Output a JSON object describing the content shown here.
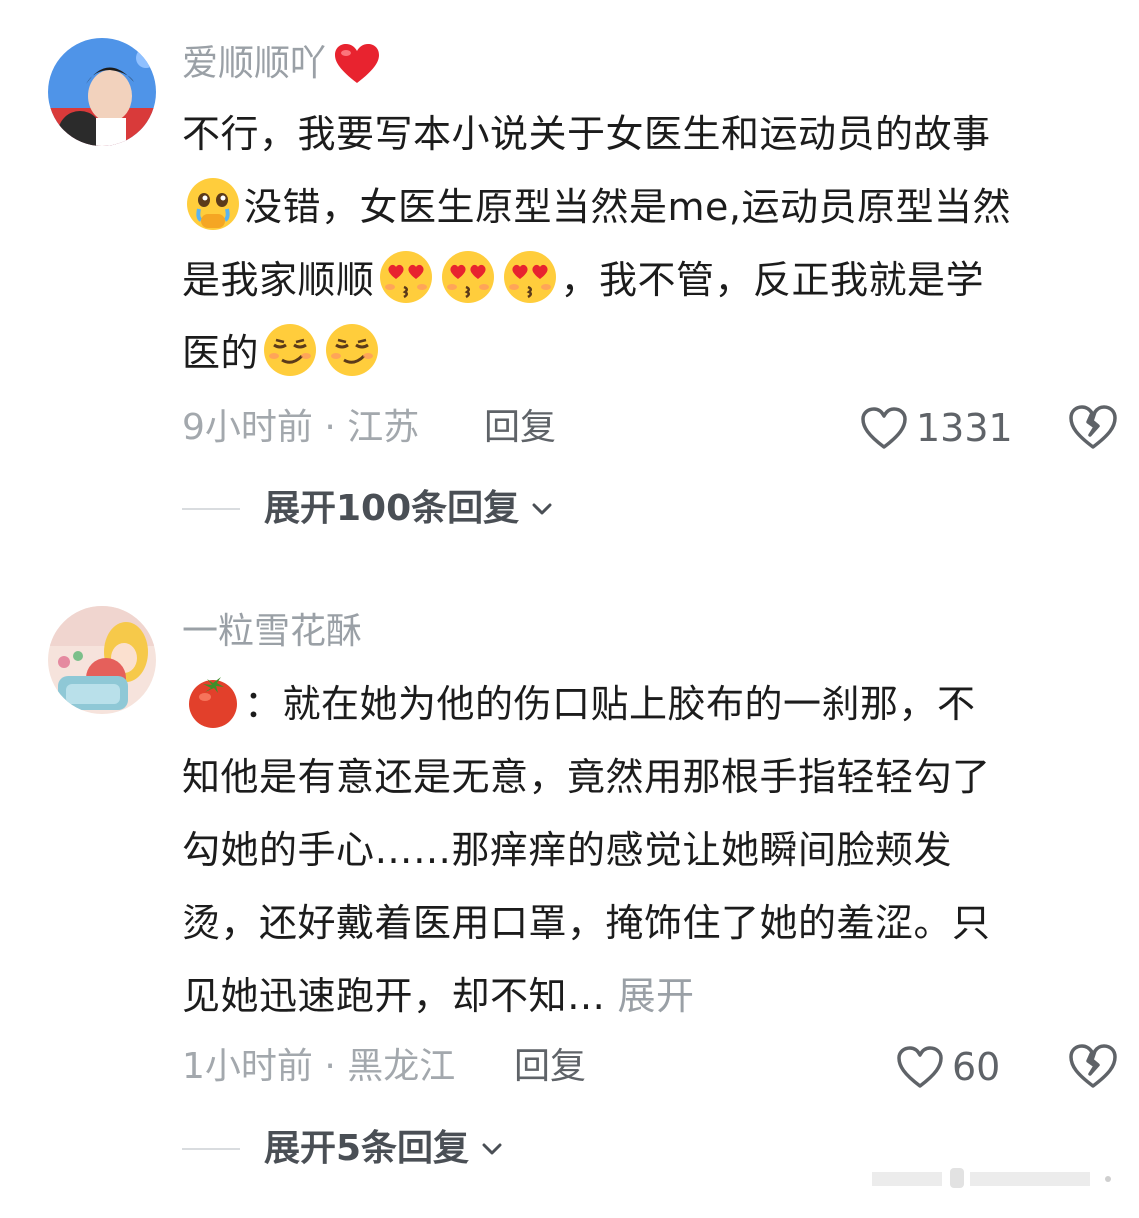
{
  "comments": [
    {
      "username": "爱顺顺吖",
      "text_line1": "不行，我要写本小说关于女医生和运动员的故事",
      "text_line2": "没错，女医生原型当然是me,运动员原型当然",
      "text_line3_a": "是我家顺顺",
      "text_line3_b": "，我不管，反正我就是学",
      "text_line4": "医的",
      "time": "9小时前",
      "location": "江苏",
      "separator": " · ",
      "reply_label": "回复",
      "likes": "1331",
      "expand_label": "展开100条回复",
      "icons": [
        "red-heart-icon",
        "holding-back-tears-emoji",
        "heart-eyes-kiss-emoji",
        "smirk-emoji",
        "heart-outline-icon",
        "broken-heart-icon",
        "chevron-down-icon"
      ]
    },
    {
      "username": "一粒雪花酥",
      "text_line1": "：就在她为他的伤口贴上胶布的一刹那，不",
      "text_line2": "知他是有意还是无意，竟然用那根手指轻轻勾了",
      "text_line3": "勾她的手心……那痒痒的感觉让她瞬间脸颊发",
      "text_line4": "烫，还好戴着医用口罩，掩饰住了她的羞涩。只",
      "text_line5": "见她迅速跑开，却不知…",
      "more_label": "展开",
      "time": "1小时前",
      "location": "黑龙江",
      "separator": " · ",
      "reply_label": "回复",
      "likes": "60",
      "expand_label": "展开5条回复",
      "icons": [
        "tomato-emoji",
        "heart-outline-icon",
        "broken-heart-icon",
        "chevron-down-icon"
      ]
    }
  ],
  "colors": {
    "username": "#9aa0a6",
    "body": "#1c1c1c",
    "meta": "#a3a8ad",
    "accent_red": "#e8232f"
  }
}
